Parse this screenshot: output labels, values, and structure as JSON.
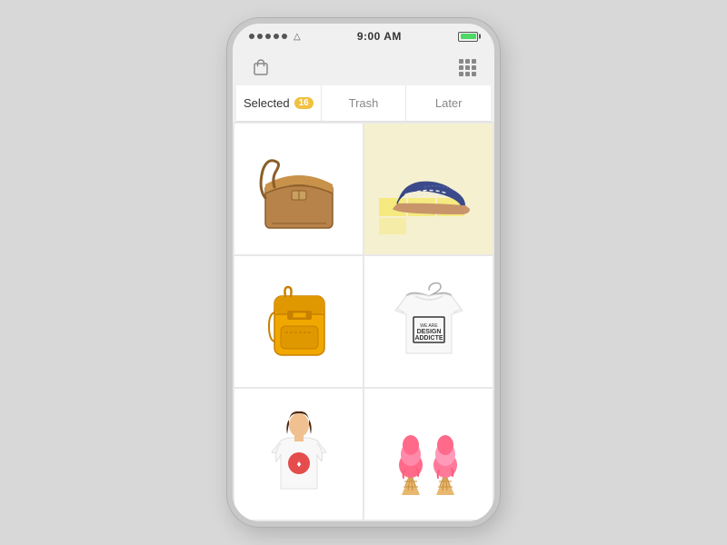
{
  "statusBar": {
    "time": "9:00 AM",
    "batteryColor": "#4cd964"
  },
  "navBar": {
    "bagIcon": "bag-icon",
    "gridIcon": "grid-icon"
  },
  "tabs": [
    {
      "id": "selected",
      "label": "Selected",
      "badge": "16",
      "active": true
    },
    {
      "id": "trash",
      "label": "Trash",
      "badge": null,
      "active": false
    },
    {
      "id": "later",
      "label": "Later",
      "badge": null,
      "active": false
    }
  ],
  "products": [
    {
      "id": 1,
      "type": "brown-bag",
      "alt": "Brown messenger bag"
    },
    {
      "id": 2,
      "type": "blue-shoe",
      "alt": "Blue suede oxford shoe"
    },
    {
      "id": 3,
      "type": "yellow-backpack",
      "alt": "Yellow backpack"
    },
    {
      "id": 4,
      "type": "design-tshirt",
      "alt": "Design Addicted t-shirt"
    },
    {
      "id": 5,
      "type": "girl-tshirt",
      "alt": "Girl wearing graphic t-shirt"
    },
    {
      "id": 6,
      "type": "ice-cream",
      "alt": "Pink ice cream cones"
    }
  ],
  "colors": {
    "accent": "#f0c040",
    "background": "#d8d8d8",
    "phoneFrame": "#c8c8c8",
    "activeTab": "#333333",
    "inactiveTab": "#888888"
  }
}
